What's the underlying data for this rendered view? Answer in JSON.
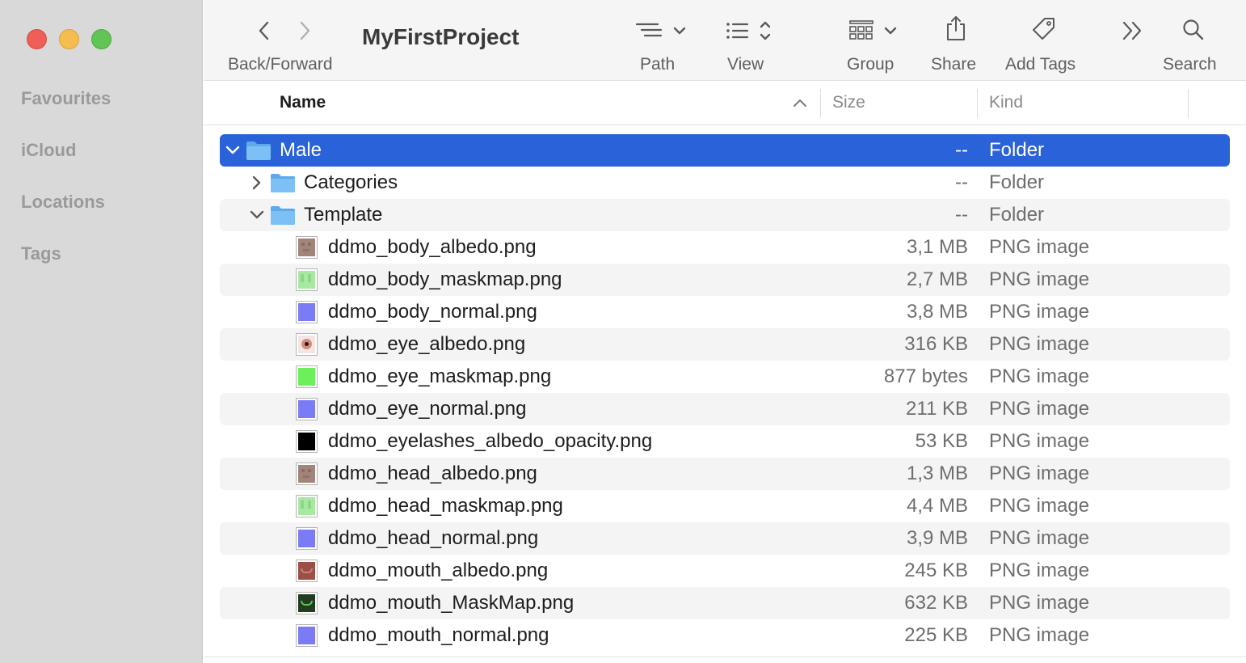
{
  "window": {
    "title": "MyFirstProject"
  },
  "sidebar": {
    "sections": [
      {
        "label": "Favourites"
      },
      {
        "label": "iCloud"
      },
      {
        "label": "Locations"
      },
      {
        "label": "Tags"
      }
    ]
  },
  "toolbar": {
    "back_forward_label": "Back/Forward",
    "path_label": "Path",
    "view_label": "View",
    "group_label": "Group",
    "share_label": "Share",
    "add_tags_label": "Add Tags",
    "search_label": "Search"
  },
  "columns": {
    "name": "Name",
    "size": "Size",
    "kind": "Kind",
    "sort_indicator": "ascending"
  },
  "rows": [
    {
      "name": "Male",
      "size": "--",
      "kind": "Folder",
      "type": "folder",
      "depth": 0,
      "expanded": true,
      "selected": true
    },
    {
      "name": "Categories",
      "size": "--",
      "kind": "Folder",
      "type": "folder",
      "depth": 1,
      "expanded": false
    },
    {
      "name": "Template",
      "size": "--",
      "kind": "Folder",
      "type": "folder",
      "depth": 1,
      "expanded": true
    },
    {
      "name": "ddmo_body_albedo.png",
      "size": "3,1 MB",
      "kind": "PNG image",
      "type": "file",
      "thumb": "skin"
    },
    {
      "name": "ddmo_body_maskmap.png",
      "size": "2,7 MB",
      "kind": "PNG image",
      "type": "file",
      "thumb": "mask"
    },
    {
      "name": "ddmo_body_normal.png",
      "size": "3,8 MB",
      "kind": "PNG image",
      "type": "file",
      "thumb": "normal"
    },
    {
      "name": "ddmo_eye_albedo.png",
      "size": "316 KB",
      "kind": "PNG image",
      "type": "file",
      "thumb": "eye"
    },
    {
      "name": "ddmo_eye_maskmap.png",
      "size": "877 bytes",
      "kind": "PNG image",
      "type": "file",
      "thumb": "green"
    },
    {
      "name": "ddmo_eye_normal.png",
      "size": "211 KB",
      "kind": "PNG image",
      "type": "file",
      "thumb": "normal"
    },
    {
      "name": "ddmo_eyelashes_albedo_opacity.png",
      "size": "53 KB",
      "kind": "PNG image",
      "type": "file",
      "thumb": "black"
    },
    {
      "name": "ddmo_head_albedo.png",
      "size": "1,3 MB",
      "kind": "PNG image",
      "type": "file",
      "thumb": "skin"
    },
    {
      "name": "ddmo_head_maskmap.png",
      "size": "4,4 MB",
      "kind": "PNG image",
      "type": "file",
      "thumb": "mask"
    },
    {
      "name": "ddmo_head_normal.png",
      "size": "3,9 MB",
      "kind": "PNG image",
      "type": "file",
      "thumb": "normal"
    },
    {
      "name": "ddmo_mouth_albedo.png",
      "size": "245 KB",
      "kind": "PNG image",
      "type": "file",
      "thumb": "mouth"
    },
    {
      "name": "ddmo_mouth_MaskMap.png",
      "size": "632 KB",
      "kind": "PNG image",
      "type": "file",
      "thumb": "mouthmask"
    },
    {
      "name": "ddmo_mouth_normal.png",
      "size": "225 KB",
      "kind": "PNG image",
      "type": "file",
      "thumb": "normal"
    }
  ],
  "colors": {
    "selection": "#2962d9",
    "folder": "#6cb6f2",
    "sidebar_bg": "#d9d9d9"
  }
}
